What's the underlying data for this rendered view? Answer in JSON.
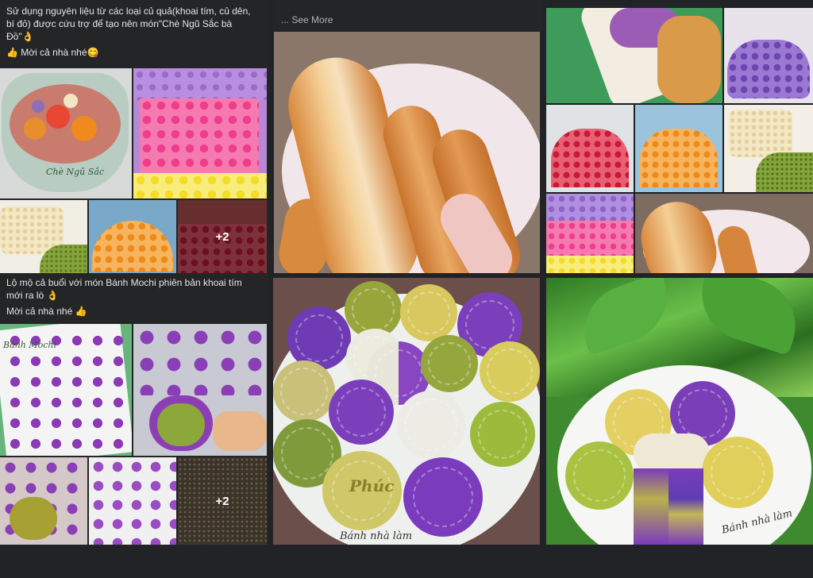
{
  "post1": {
    "text_line1": "Sử dụng nguyên liệu từ các loại củ quả(khoai tím, củ dên,",
    "text_line2": "bí đỏ) được cứu trợ để tạo nên món\"Chè Ngũ Sắc bà",
    "text_line3": "Đồ\"👌",
    "text_line4": "👍 Mời cả nhà nhé😋",
    "caption": "Chè Ngũ Sắc",
    "more_count": "+2"
  },
  "post2": {
    "see_more": "... See More"
  },
  "post3": {},
  "post4": {
    "text_line1": "Lộ mộ cả buổi với món Bánh Mochi phiên bản khoai tím",
    "text_line2": "mới ra lò 👌",
    "text_line3": "Mời cả nhà nhé 👍",
    "caption": "Bánh Mochi",
    "more_count": "+2"
  },
  "post5": {
    "caption": "Bánh nhà làm",
    "stamp": "Phúc"
  },
  "post6": {
    "caption": "Bánh nhà làm"
  },
  "colors": {
    "background": "#222326",
    "text": "#e4e6eb",
    "muted": "#b0b3b8"
  }
}
